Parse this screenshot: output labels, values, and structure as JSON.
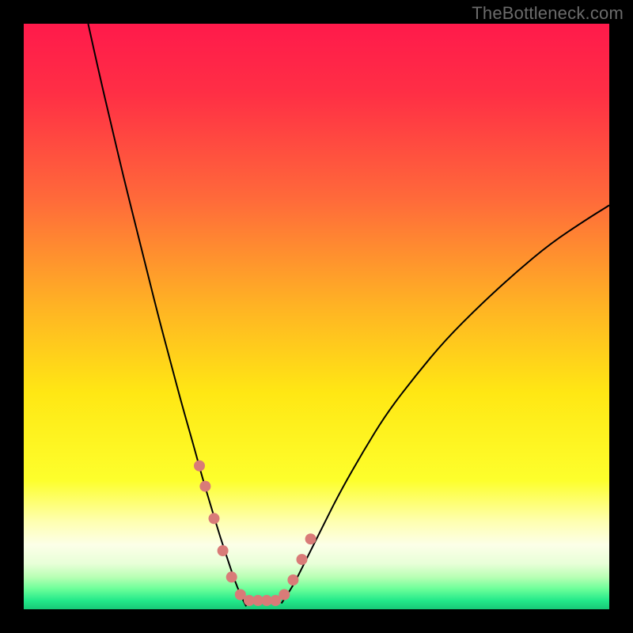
{
  "watermark": "TheBottleneck.com",
  "chart_data": {
    "type": "line",
    "title": "",
    "xlabel": "",
    "ylabel": "",
    "xlim": [
      0,
      100
    ],
    "ylim": [
      0,
      100
    ],
    "gradient_stops": [
      {
        "offset": 0,
        "color": "#ff1a4b"
      },
      {
        "offset": 12,
        "color": "#ff2f45"
      },
      {
        "offset": 30,
        "color": "#ff6a3a"
      },
      {
        "offset": 48,
        "color": "#ffb224"
      },
      {
        "offset": 63,
        "color": "#ffe714"
      },
      {
        "offset": 78,
        "color": "#fdff2c"
      },
      {
        "offset": 85,
        "color": "#feffb0"
      },
      {
        "offset": 89,
        "color": "#fcffe8"
      },
      {
        "offset": 92.2,
        "color": "#e8ffd8"
      },
      {
        "offset": 94.5,
        "color": "#b8ffb4"
      },
      {
        "offset": 96.5,
        "color": "#6dff9a"
      },
      {
        "offset": 98.5,
        "color": "#23e98a"
      },
      {
        "offset": 100,
        "color": "#18c977"
      }
    ],
    "series": [
      {
        "name": "left-curve",
        "color": "#000000",
        "x": [
          11,
          13,
          15,
          17,
          19,
          21,
          23,
          25,
          27,
          29,
          30.5,
          32,
          33.5,
          35,
          36,
          37,
          38
        ],
        "y": [
          100,
          91,
          82.5,
          74,
          66,
          58,
          50,
          42.5,
          35,
          28,
          22.5,
          17.5,
          12.5,
          8,
          5,
          2.5,
          0.5
        ]
      },
      {
        "name": "right-curve",
        "color": "#000000",
        "x": [
          44,
          46,
          48,
          51,
          54,
          58,
          62,
          67,
          72,
          78,
          84,
          90,
          96,
          100
        ],
        "y": [
          1,
          4,
          8,
          14,
          20,
          27,
          33.5,
          40,
          46,
          52,
          57.5,
          62.5,
          66.5,
          69
        ]
      }
    ],
    "dots": {
      "color": "#d97b78",
      "radius": 7,
      "points": [
        {
          "x": 30.0,
          "y": 24.5
        },
        {
          "x": 31.0,
          "y": 21.0
        },
        {
          "x": 32.5,
          "y": 15.5
        },
        {
          "x": 34.0,
          "y": 10.0
        },
        {
          "x": 35.5,
          "y": 5.5
        },
        {
          "x": 37.0,
          "y": 2.5
        },
        {
          "x": 38.5,
          "y": 1.5
        },
        {
          "x": 40.0,
          "y": 1.5
        },
        {
          "x": 41.5,
          "y": 1.5
        },
        {
          "x": 43.0,
          "y": 1.5
        },
        {
          "x": 44.5,
          "y": 2.5
        },
        {
          "x": 46.0,
          "y": 5.0
        },
        {
          "x": 47.5,
          "y": 8.5
        },
        {
          "x": 49.0,
          "y": 12.0
        }
      ]
    }
  }
}
